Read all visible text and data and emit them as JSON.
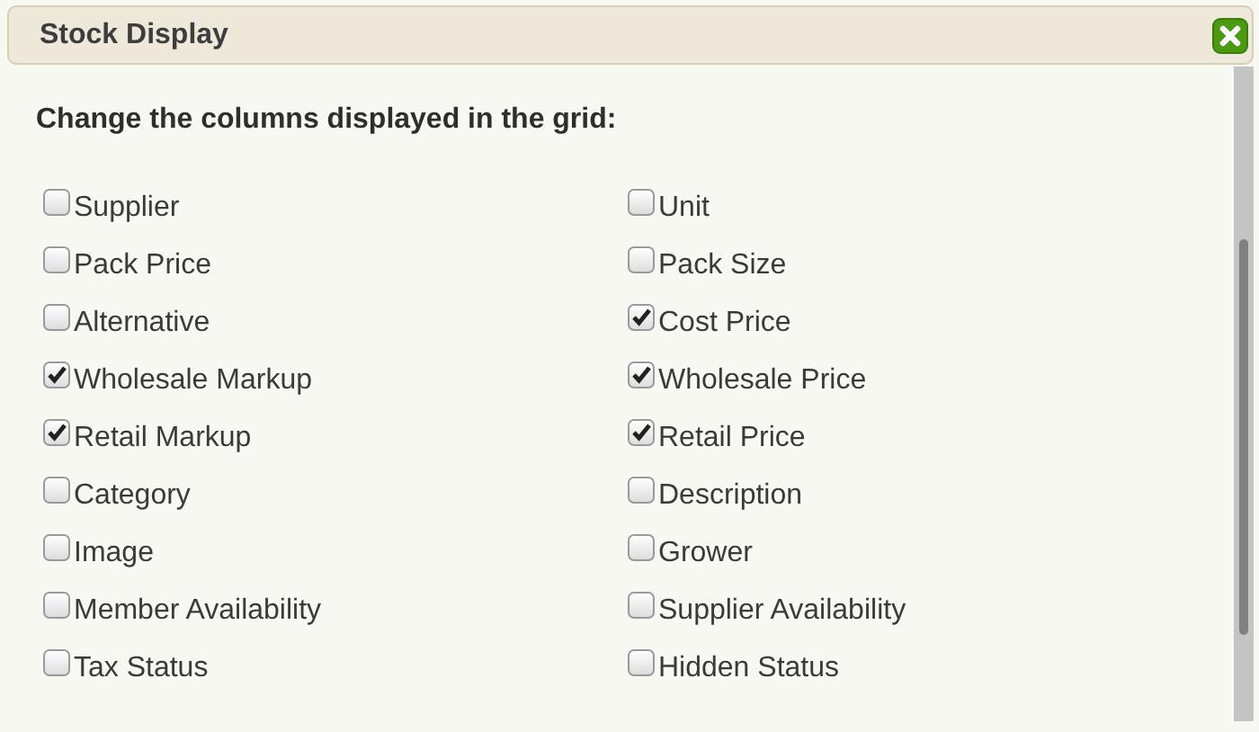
{
  "dialog": {
    "title": "Stock Display"
  },
  "heading": "Change the columns displayed in the grid:",
  "options": [
    {
      "label": "Supplier",
      "checked": false
    },
    {
      "label": "Unit",
      "checked": false
    },
    {
      "label": "Pack Price",
      "checked": false
    },
    {
      "label": "Pack Size",
      "checked": false
    },
    {
      "label": "Alternative",
      "checked": false
    },
    {
      "label": "Cost Price",
      "checked": true
    },
    {
      "label": "Wholesale Markup",
      "checked": true
    },
    {
      "label": "Wholesale Price",
      "checked": true
    },
    {
      "label": "Retail Markup",
      "checked": true
    },
    {
      "label": "Retail Price",
      "checked": true
    },
    {
      "label": "Category",
      "checked": false
    },
    {
      "label": "Description",
      "checked": false
    },
    {
      "label": "Image",
      "checked": false
    },
    {
      "label": "Grower",
      "checked": false
    },
    {
      "label": "Member Availability",
      "checked": false
    },
    {
      "label": "Supplier Availability",
      "checked": false
    },
    {
      "label": "Tax Status",
      "checked": false
    },
    {
      "label": "Hidden Status",
      "checked": false
    }
  ]
}
